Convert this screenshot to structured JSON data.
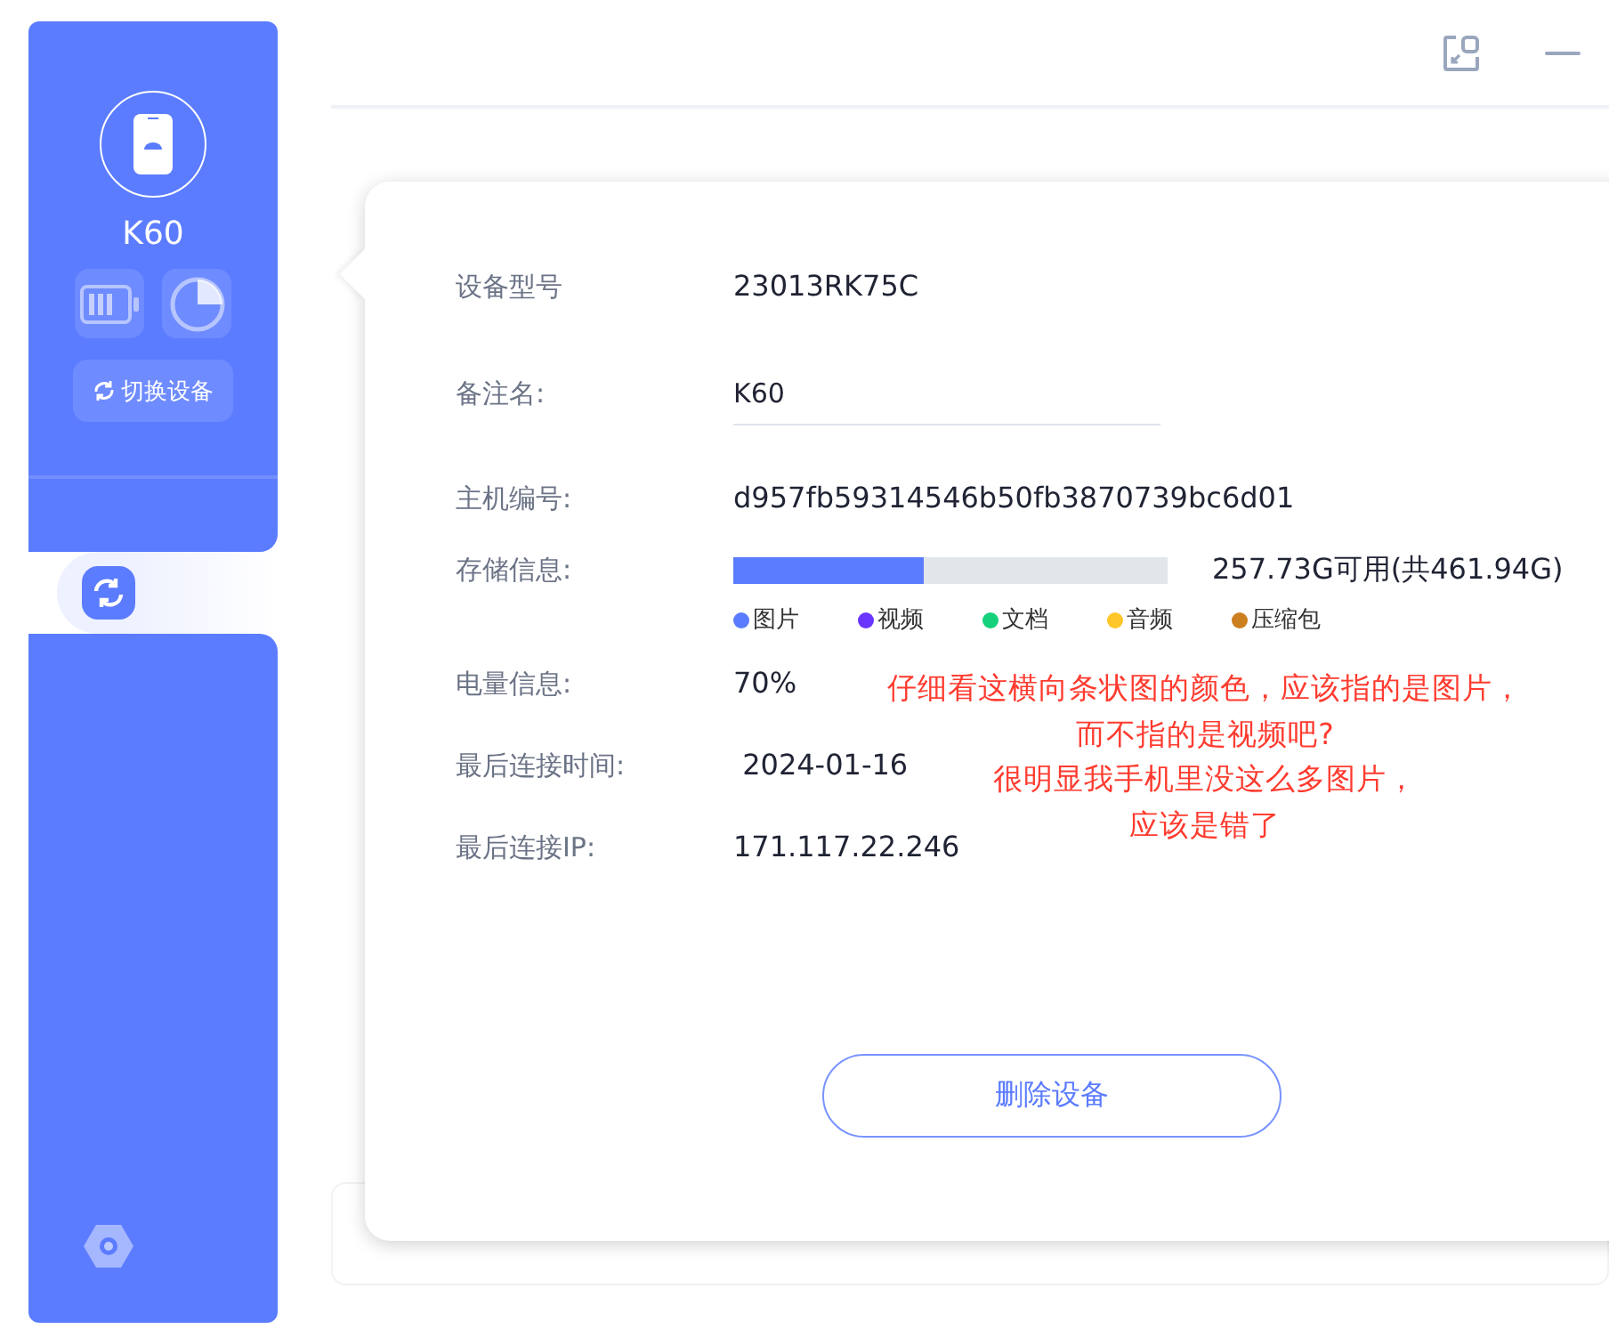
{
  "sidebar": {
    "device_name": "K60",
    "switch_button": "切换设备",
    "nav_items": [
      {
        "selected": true
      }
    ]
  },
  "device_info": {
    "rows": [
      {
        "kind": "text",
        "label": "设备型号",
        "value": "23013RK75C"
      },
      {
        "kind": "field",
        "label": "备注名:",
        "value": "K60"
      },
      {
        "kind": "text",
        "label": "主机编号:",
        "value": "d957fb59314546b50fb3870739bc6d01"
      },
      {
        "kind": "storage",
        "label": "存储信息:",
        "value": "257.73G可用(共461.94G)"
      },
      {
        "kind": "text",
        "label": "电量信息:",
        "value": "70%"
      },
      {
        "kind": "text",
        "label": "最后连接时间:",
        "value": " 2024-01-16"
      },
      {
        "kind": "text",
        "label": "最后连接IP:",
        "value": "171.117.22.246"
      }
    ],
    "storage_segments": [
      {
        "name": "图片",
        "color": "#5b7cff",
        "level": 0.44
      },
      {
        "name": "视频",
        "color": "#6a35ff"
      },
      {
        "name": "文档",
        "color": "#16d17b"
      },
      {
        "name": "音频",
        "color": "#ffc629"
      },
      {
        "name": "压缩包",
        "color": "#cc7f1e"
      }
    ],
    "delete_button": "删除设备"
  },
  "annotation": [
    "仔细看这横向条状图的颜色，应该指的是图片，",
    "而不指的是视频吧?",
    "很明显我手机里没这么多图片，",
    "应该是错了"
  ]
}
